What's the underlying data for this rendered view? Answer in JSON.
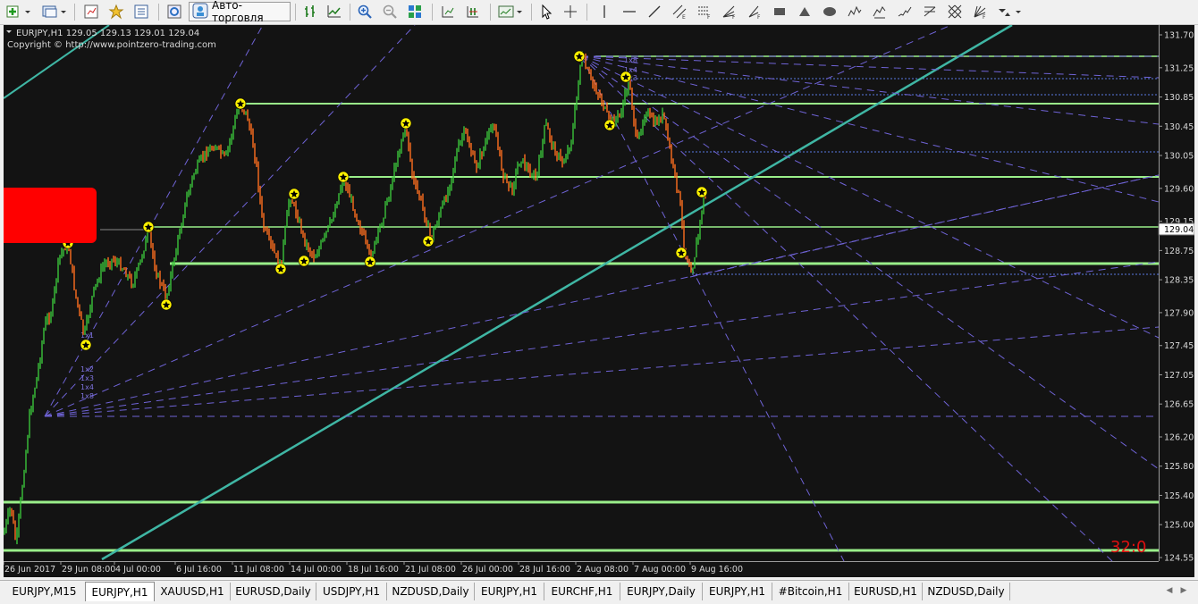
{
  "toolbar": {
    "auto_trading_label": "Авто-торговля",
    "icons": [
      "new-order-icon",
      "profiles-icon",
      "market-watch-icon",
      "favorites-icon",
      "navigator-icon",
      "strategy-tester-icon",
      "autotrading-icon",
      "bar-chart-icon",
      "line-chart-icon",
      "zoom-in-icon",
      "zoom-out-icon",
      "tile-windows-icon",
      "chart-shift-icon",
      "autoscroll-icon",
      "templates-icon",
      "cursor-icon",
      "crosshair-icon",
      "vertical-line-icon",
      "horizontal-line-icon",
      "trendline-icon",
      "equidistant-channel-icon",
      "fibo-retracement-icon",
      "fibo-fan-icon",
      "rectangle-icon",
      "triangle-icon",
      "ellipse-icon",
      "elliott-wave-icon",
      "pitchfork-icon",
      "gann-grid-icon",
      "gann-fan-icon",
      "arrows-icon"
    ]
  },
  "chart": {
    "header": "EURJPY,H1  129.05 129.13 129.01 129.04",
    "copyright": "Copyright © http://www.pointzero-trading.com",
    "current_price": "129.04",
    "timer": "32:0",
    "price_labels": [
      "131.70",
      "131.25",
      "130.85",
      "130.45",
      "130.05",
      "129.60",
      "129.15",
      "128.75",
      "128.35",
      "127.90",
      "127.45",
      "127.05",
      "126.65",
      "126.20",
      "125.80",
      "125.40",
      "125.00",
      "124.55"
    ],
    "time_labels": [
      "26 Jun 2017",
      "29 Jun 08:00",
      "4 Jul 00:00",
      "6 Jul 16:00",
      "11 Jul 08:00",
      "14 Jul 00:00",
      "18 Jul 16:00",
      "21 Jul 08:00",
      "26 Jul 00:00",
      "28 Jul 16:00",
      "2 Aug 08:00",
      "7 Aug 00:00",
      "9 Aug 16:00"
    ],
    "gann_labels_low": [
      "1x1",
      "1x2",
      "1x3",
      "1x4",
      "1x8"
    ],
    "gann_labels_high": [
      "1x8",
      "1x4",
      "1x3"
    ],
    "colors": {
      "background": "#131313",
      "support": "#9aef8a",
      "trendline": "#3fb6a4",
      "gann": "#6f63d6",
      "candle_up": "#3bc43b",
      "candle_down": "#ff6f1f",
      "marker": "#fff200",
      "timer": "#e01010",
      "alert_box": "#ff0000"
    }
  },
  "tabs": [
    {
      "label": "EURJPY,M15",
      "active": false
    },
    {
      "label": "EURJPY,H1",
      "active": true
    },
    {
      "label": "XAUUSD,H1",
      "active": false
    },
    {
      "label": "EURUSD,Daily",
      "active": false
    },
    {
      "label": "USDJPY,H1",
      "active": false
    },
    {
      "label": "NZDUSD,Daily",
      "active": false
    },
    {
      "label": "EURJPY,H1",
      "active": false
    },
    {
      "label": "EURCHF,H1",
      "active": false
    },
    {
      "label": "EURJPY,Daily",
      "active": false
    },
    {
      "label": "EURJPY,H1",
      "active": false
    },
    {
      "label": "#Bitcoin,H1",
      "active": false
    },
    {
      "label": "EURUSD,H1",
      "active": false
    },
    {
      "label": "NZDUSD,Daily",
      "active": false
    }
  ]
}
